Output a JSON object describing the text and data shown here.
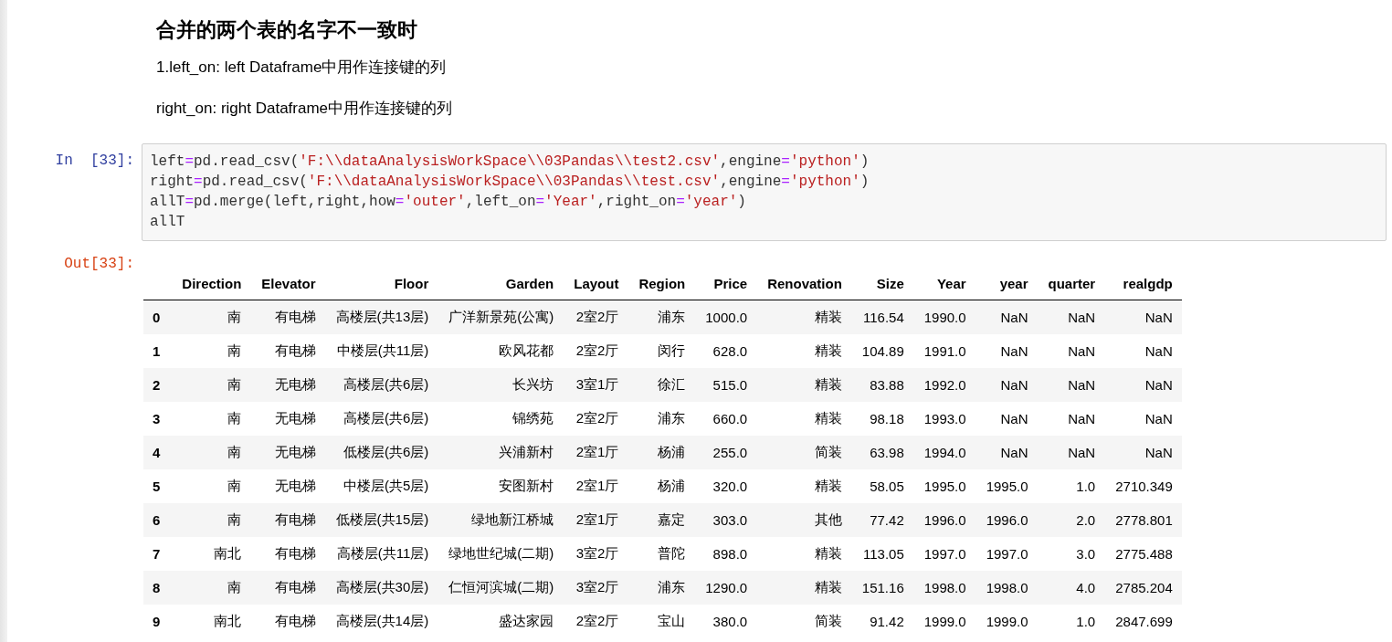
{
  "markdown": {
    "heading": "合并的两个表的名字不一致时",
    "paragraphs": [
      "1.left_on: left Dataframe中用作连接键的列",
      "right_on: right Dataframe中用作连接键的列"
    ]
  },
  "input_cell": {
    "prompt": "In  [33]:",
    "lines": [
      [
        {
          "kind": "name",
          "text": "left"
        },
        {
          "kind": "op",
          "text": "="
        },
        {
          "kind": "name",
          "text": "pd.read_csv("
        },
        {
          "kind": "string",
          "text": "'F:\\\\dataAnalysisWorkSpace\\\\03Pandas\\\\test2.csv'"
        },
        {
          "kind": "name",
          "text": ",engine"
        },
        {
          "kind": "op",
          "text": "="
        },
        {
          "kind": "string",
          "text": "'python'"
        },
        {
          "kind": "name",
          "text": ")"
        }
      ],
      [
        {
          "kind": "name",
          "text": "right"
        },
        {
          "kind": "op",
          "text": "="
        },
        {
          "kind": "name",
          "text": "pd.read_csv("
        },
        {
          "kind": "string",
          "text": "'F:\\\\dataAnalysisWorkSpace\\\\03Pandas\\\\test.csv'"
        },
        {
          "kind": "name",
          "text": ",engine"
        },
        {
          "kind": "op",
          "text": "="
        },
        {
          "kind": "string",
          "text": "'python'"
        },
        {
          "kind": "name",
          "text": ")"
        }
      ],
      [
        {
          "kind": "name",
          "text": "allT"
        },
        {
          "kind": "op",
          "text": "="
        },
        {
          "kind": "name",
          "text": "pd.merge(left,right,how"
        },
        {
          "kind": "op",
          "text": "="
        },
        {
          "kind": "string",
          "text": "'outer'"
        },
        {
          "kind": "name",
          "text": ",left_on"
        },
        {
          "kind": "op",
          "text": "="
        },
        {
          "kind": "string",
          "text": "'Year'"
        },
        {
          "kind": "name",
          "text": ",right_on"
        },
        {
          "kind": "op",
          "text": "="
        },
        {
          "kind": "string",
          "text": "'year'"
        },
        {
          "kind": "name",
          "text": ")"
        }
      ],
      [
        {
          "kind": "name",
          "text": "allT"
        }
      ]
    ]
  },
  "output_cell": {
    "prompt": "Out[33]:",
    "table": {
      "columns": [
        "Direction",
        "Elevator",
        "Floor",
        "Garden",
        "Layout",
        "Region",
        "Price",
        "Renovation",
        "Size",
        "Year",
        "year",
        "quarter",
        "realgdp"
      ],
      "rows": [
        {
          "index": "0",
          "cells": [
            "南",
            "有电梯",
            "高楼层(共13层)",
            "广洋新景苑(公寓)",
            "2室2厅",
            "浦东",
            "1000.0",
            "精装",
            "116.54",
            "1990.0",
            "NaN",
            "NaN",
            "NaN"
          ]
        },
        {
          "index": "1",
          "cells": [
            "南",
            "有电梯",
            "中楼层(共11层)",
            "欧风花都",
            "2室2厅",
            "闵行",
            "628.0",
            "精装",
            "104.89",
            "1991.0",
            "NaN",
            "NaN",
            "NaN"
          ]
        },
        {
          "index": "2",
          "cells": [
            "南",
            "无电梯",
            "高楼层(共6层)",
            "长兴坊",
            "3室1厅",
            "徐汇",
            "515.0",
            "精装",
            "83.88",
            "1992.0",
            "NaN",
            "NaN",
            "NaN"
          ]
        },
        {
          "index": "3",
          "cells": [
            "南",
            "无电梯",
            "高楼层(共6层)",
            "锦绣苑",
            "2室2厅",
            "浦东",
            "660.0",
            "精装",
            "98.18",
            "1993.0",
            "NaN",
            "NaN",
            "NaN"
          ]
        },
        {
          "index": "4",
          "cells": [
            "南",
            "无电梯",
            "低楼层(共6层)",
            "兴浦新村",
            "2室1厅",
            "杨浦",
            "255.0",
            "简装",
            "63.98",
            "1994.0",
            "NaN",
            "NaN",
            "NaN"
          ]
        },
        {
          "index": "5",
          "cells": [
            "南",
            "无电梯",
            "中楼层(共5层)",
            "安图新村",
            "2室1厅",
            "杨浦",
            "320.0",
            "精装",
            "58.05",
            "1995.0",
            "1995.0",
            "1.0",
            "2710.349"
          ]
        },
        {
          "index": "6",
          "cells": [
            "南",
            "有电梯",
            "低楼层(共15层)",
            "绿地新江桥城",
            "2室1厅",
            "嘉定",
            "303.0",
            "其他",
            "77.42",
            "1996.0",
            "1996.0",
            "2.0",
            "2778.801"
          ]
        },
        {
          "index": "7",
          "cells": [
            "南北",
            "有电梯",
            "高楼层(共11层)",
            "绿地世纪城(二期)",
            "3室2厅",
            "普陀",
            "898.0",
            "精装",
            "113.05",
            "1997.0",
            "1997.0",
            "3.0",
            "2775.488"
          ]
        },
        {
          "index": "8",
          "cells": [
            "南",
            "有电梯",
            "高楼层(共30层)",
            "仁恒河滨城(二期)",
            "3室2厅",
            "浦东",
            "1290.0",
            "精装",
            "151.16",
            "1998.0",
            "1998.0",
            "4.0",
            "2785.204"
          ]
        },
        {
          "index": "9",
          "cells": [
            "南北",
            "有电梯",
            "高楼层(共14层)",
            "盛达家园",
            "2室2厅",
            "宝山",
            "380.0",
            "简装",
            "91.42",
            "1999.0",
            "1999.0",
            "1.0",
            "2847.699"
          ]
        }
      ]
    }
  }
}
